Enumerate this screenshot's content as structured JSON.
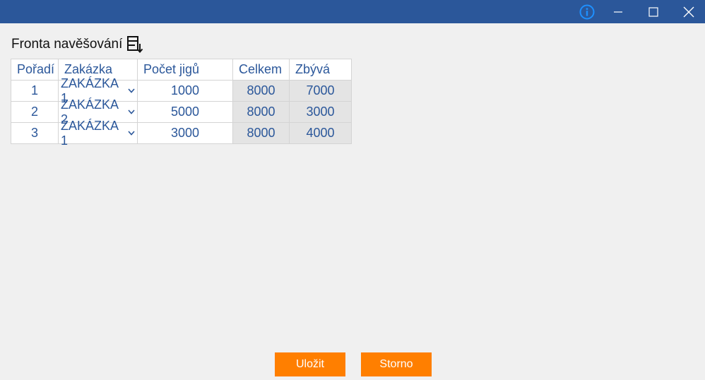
{
  "window": {
    "title_icons": [
      "info-icon",
      "minimize-icon",
      "maximize-icon",
      "close-icon"
    ]
  },
  "heading": {
    "title": "Fronta navěšování",
    "icon": "queue-download-icon"
  },
  "table": {
    "headers": {
      "order": "Pořadí",
      "job": "Zakázka",
      "count": "Počet jigů",
      "total": "Celkem",
      "remaining": "Zbývá"
    },
    "rows": [
      {
        "order": "1",
        "job": "ZAKÁZKA 1",
        "count": "1000",
        "total": "8000",
        "remaining": "7000"
      },
      {
        "order": "2",
        "job": "ZAKÁZKA 2",
        "count": "5000",
        "total": "8000",
        "remaining": "3000"
      },
      {
        "order": "3",
        "job": "ZAKÁZKA 1",
        "count": "3000",
        "total": "8000",
        "remaining": "4000"
      }
    ]
  },
  "buttons": {
    "save": "Uložit",
    "cancel": "Storno"
  },
  "colors": {
    "titlebar": "#2b579a",
    "accent_button": "#ff7f00",
    "table_text": "#2b579a",
    "readonly_cell": "#e4e4e4"
  }
}
